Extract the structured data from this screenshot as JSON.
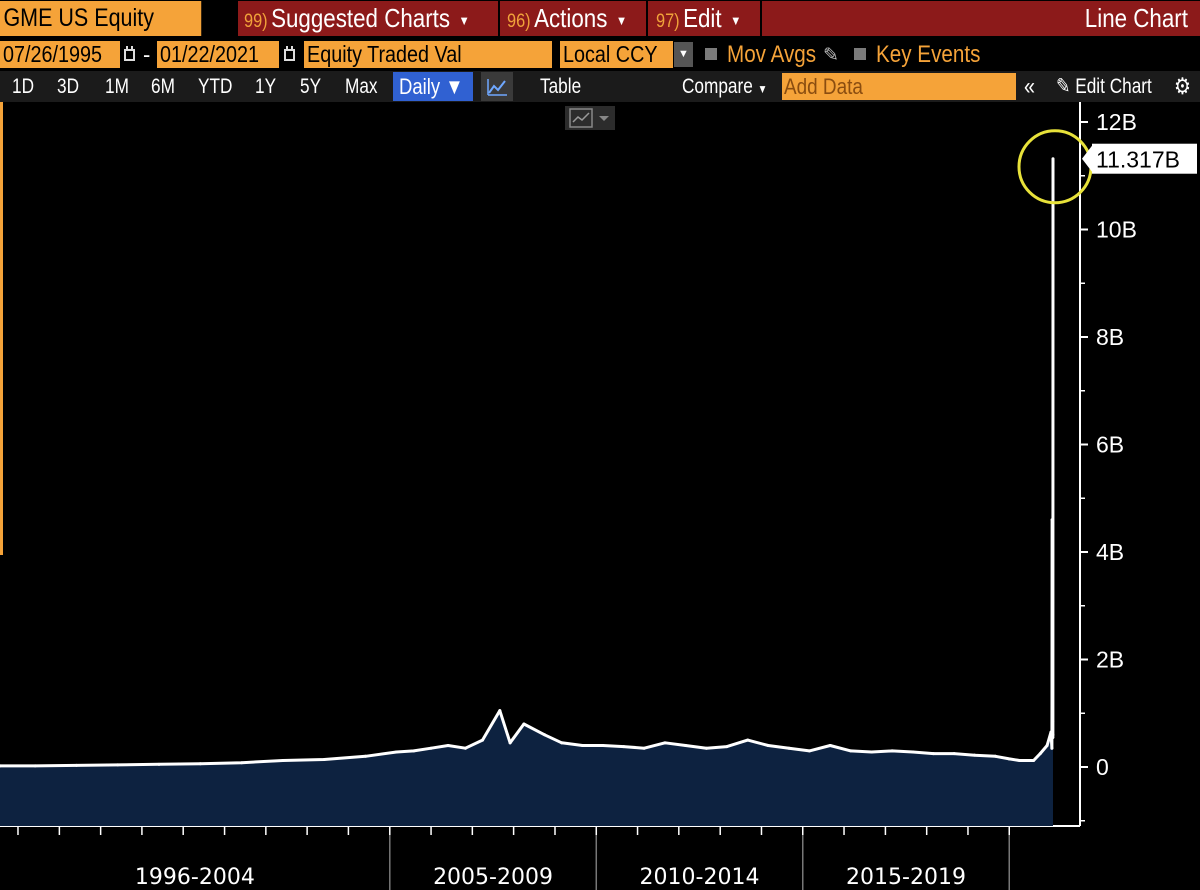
{
  "header": {
    "ticker": "GME US Equity",
    "menus": [
      {
        "num": "99)",
        "label": "Suggested Charts"
      },
      {
        "num": "96)",
        "label": "Actions"
      },
      {
        "num": "97)",
        "label": "Edit"
      }
    ],
    "chart_title": "Line Chart"
  },
  "selection": {
    "start_date": "07/26/1995",
    "end_date": "01/22/2021",
    "field": "Equity Traded Val",
    "currency": "Local CCY",
    "mov_avgs": "Mov Avgs",
    "key_events": "Key Events"
  },
  "toolbar": {
    "periods": [
      "1D",
      "3D",
      "1M",
      "6M",
      "YTD",
      "1Y",
      "5Y",
      "Max"
    ],
    "frequency": "Daily",
    "table": "Table",
    "compare": "Compare",
    "add_data_placeholder": "Add Data",
    "edit_chart": "Edit Chart",
    "collapse": "«"
  },
  "colors": {
    "orange": "#f5a339",
    "red": "#8c1a1a",
    "blue": "#3061d2",
    "area_fill": "#0d2240",
    "line": "#ffffff",
    "highlight_circle": "#e8e23a"
  },
  "icons": [
    "calendar-icon",
    "dropdown-arrow-icon",
    "pencil-icon",
    "line-chart-icon",
    "chevrons-left-icon",
    "gear-icon"
  ],
  "chart_data": {
    "type": "area",
    "field": "Equity Traded Val",
    "y_unit": "B",
    "ylim": [
      -1,
      12.5
    ],
    "yticks": [
      0,
      2,
      4,
      6,
      8,
      10,
      12
    ],
    "ytick_labels": [
      "0",
      "2B",
      "4B",
      "6B",
      "8B",
      "10B",
      "12B"
    ],
    "last_value": 11.317,
    "last_value_label": "11.317B",
    "x_groups": [
      "1996-2004",
      "2005-2009",
      "2010-2014",
      "2015-2019"
    ],
    "x_range": [
      "1995-07-26",
      "2021-01-22"
    ],
    "series": [
      {
        "x": [
          "1995-07-26",
          "1996-06-01",
          "1997-06-01",
          "1998-06-01",
          "1999-06-01",
          "2000-06-01",
          "2001-06-01",
          "2002-06-01",
          "2003-06-01",
          "2004-06-01",
          "2005-03-01",
          "2005-08-01",
          "2006-01-01",
          "2006-06-01",
          "2006-11-01",
          "2007-04-01",
          "2007-09-01",
          "2007-12-01",
          "2008-04-01",
          "2008-10-01",
          "2009-03-01",
          "2009-09-01",
          "2010-03-01",
          "2010-09-01",
          "2011-03-01",
          "2011-09-01",
          "2012-03-01",
          "2012-09-01",
          "2013-03-01",
          "2013-09-01",
          "2014-03-01",
          "2014-09-01",
          "2015-03-01",
          "2015-09-01",
          "2016-03-01",
          "2016-09-01",
          "2017-03-01",
          "2017-09-01",
          "2018-03-01",
          "2018-09-01",
          "2019-03-01",
          "2019-09-01",
          "2020-01-02",
          "2020-04-01",
          "2020-08-03",
          "2020-10-01",
          "2020-12-01",
          "2021-01-04",
          "2021-01-12",
          "2021-01-13",
          "2021-01-14",
          "2021-01-15",
          "2021-01-19",
          "2021-01-20",
          "2021-01-21",
          "2021-01-22"
        ],
        "values": [
          0.02,
          0.02,
          0.03,
          0.04,
          0.05,
          0.06,
          0.08,
          0.12,
          0.14,
          0.2,
          0.28,
          0.3,
          0.35,
          0.4,
          0.35,
          0.5,
          1.05,
          0.45,
          0.8,
          0.6,
          0.45,
          0.4,
          0.4,
          0.38,
          0.35,
          0.45,
          0.4,
          0.35,
          0.38,
          0.5,
          0.4,
          0.35,
          0.3,
          0.4,
          0.3,
          0.28,
          0.3,
          0.28,
          0.25,
          0.25,
          0.22,
          0.2,
          0.15,
          0.12,
          0.12,
          0.25,
          0.4,
          0.65,
          0.35,
          1.25,
          4.6,
          1.15,
          0.85,
          0.55,
          0.6,
          11.317
        ]
      }
    ]
  }
}
